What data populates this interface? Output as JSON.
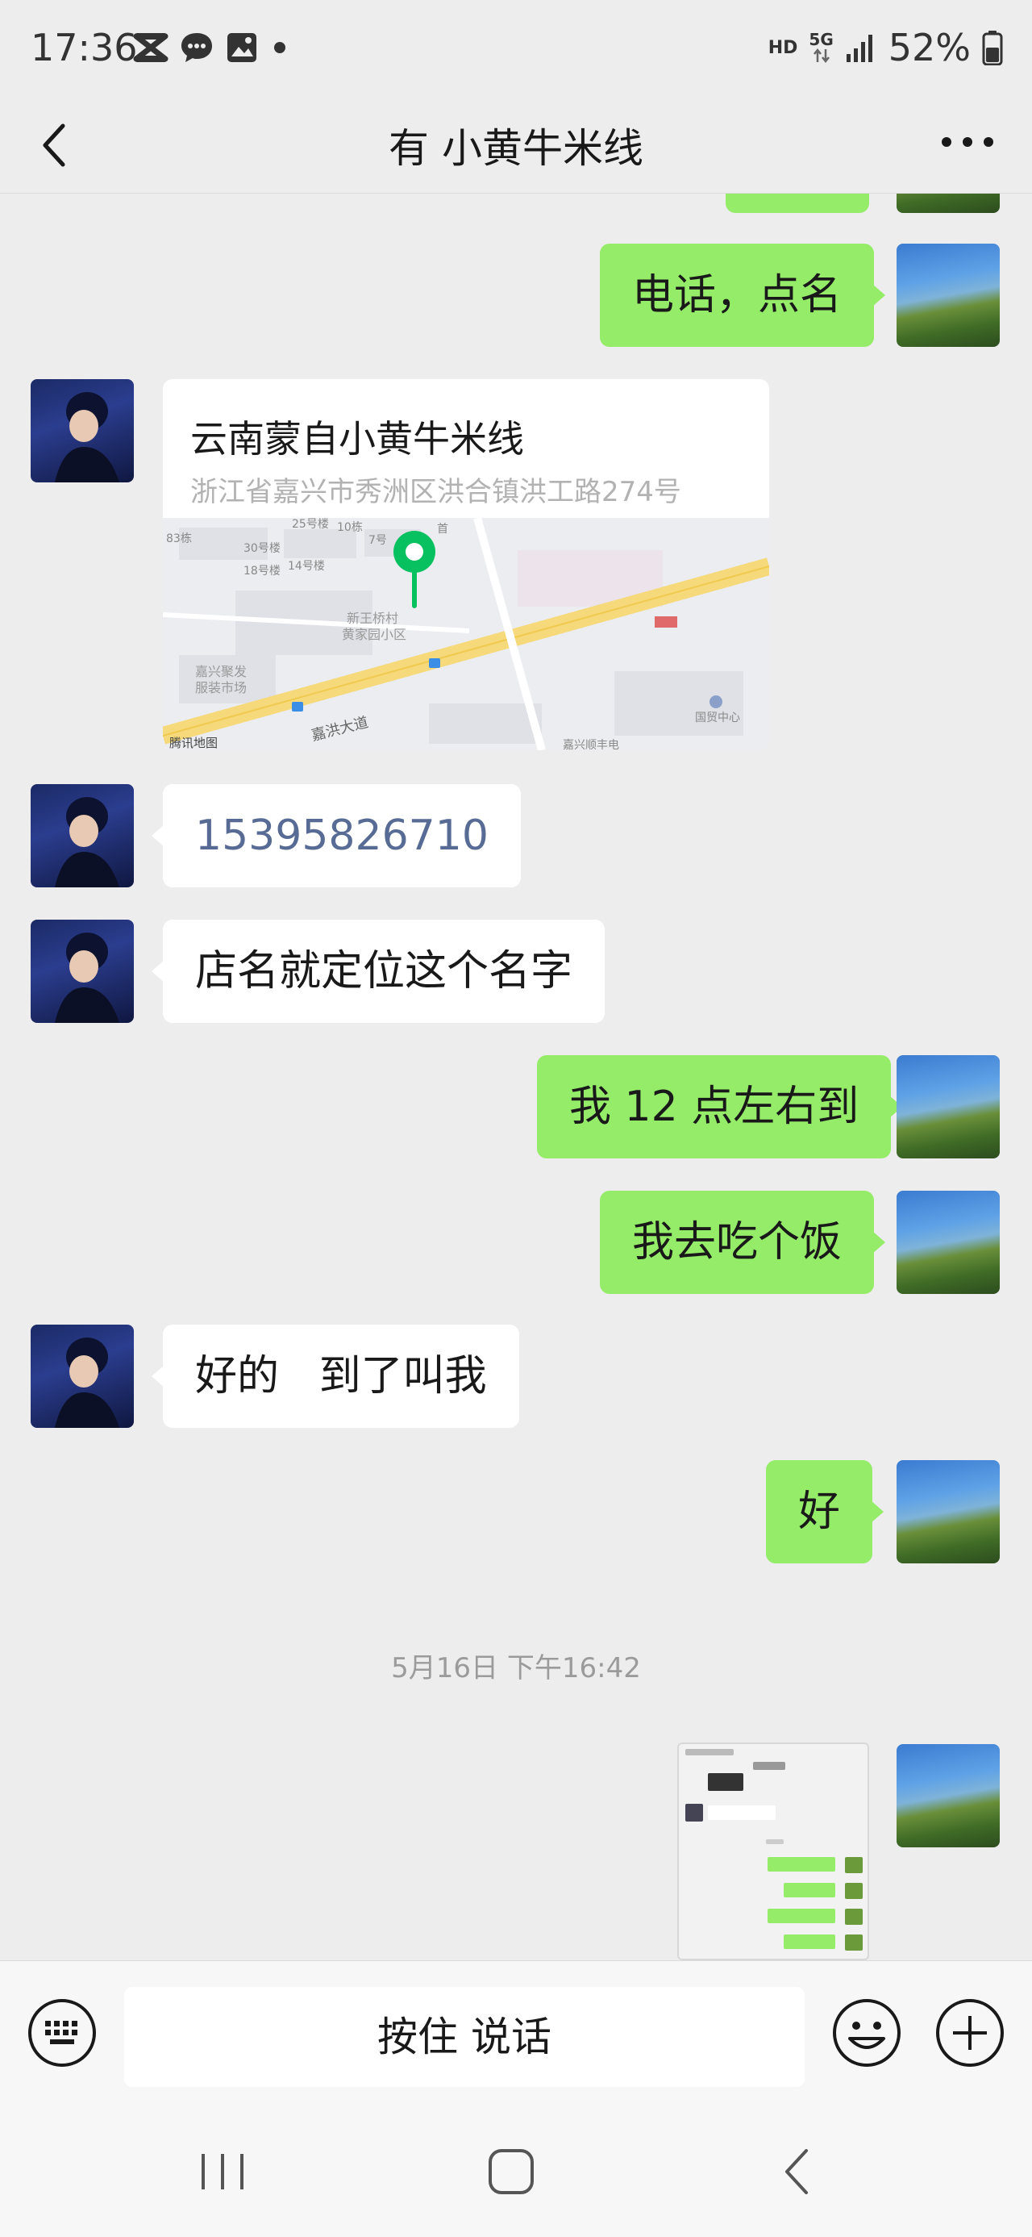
{
  "status_bar": {
    "time": "17:36",
    "network_hd": "HD",
    "network_type": "5G",
    "battery": "52%",
    "icons": [
      "capcut-icon",
      "chat-bubble-icon",
      "gallery-icon",
      "dot-icon",
      "signal-icon",
      "battery-icon"
    ]
  },
  "header": {
    "title": "有 小黄牛米线",
    "back_icon": "chevron-left-icon",
    "more_icon": "more-dots-icon"
  },
  "messages": [
    {
      "from": "self",
      "text": "电话，点名"
    },
    {
      "from": "other",
      "type": "location",
      "title": "云南蒙自小黄牛米线",
      "address": "浙江省嘉兴市秀洲区洪合镇洪工路274号"
    },
    {
      "from": "other",
      "text": "15395826710"
    },
    {
      "from": "other",
      "text": "店名就定位这个名字"
    },
    {
      "from": "self",
      "text": "我 12 点左右到"
    },
    {
      "from": "self",
      "text": "我去吃个饭"
    },
    {
      "from": "other",
      "text": "好的   到了叫我"
    },
    {
      "from": "self",
      "text": "好"
    },
    {
      "from": "self",
      "type": "image",
      "text": "screenshot"
    }
  ],
  "map": {
    "brand": "腾讯地图",
    "labels": [
      "25号楼",
      "10栋",
      "30号楼",
      "7号",
      "18号楼",
      "14号楼",
      "83栋",
      "新王桥村",
      "黄家园小区",
      "嘉兴聚发",
      "服装市场",
      "嘉洪大道",
      "国贸中心",
      "嘉兴顺丰电",
      "首"
    ],
    "pin_color": "#07c160"
  },
  "timestamp": "5月16日 下午16:42",
  "input": {
    "voice_label": "按住 说话",
    "keyboard_icon": "keyboard-icon",
    "emoji_icon": "emoji-icon",
    "plus_icon": "plus-icon"
  },
  "colors": {
    "self_bubble": "#95ec69",
    "other_bubble": "#ffffff",
    "background": "#ededed",
    "link": "#576b95"
  }
}
